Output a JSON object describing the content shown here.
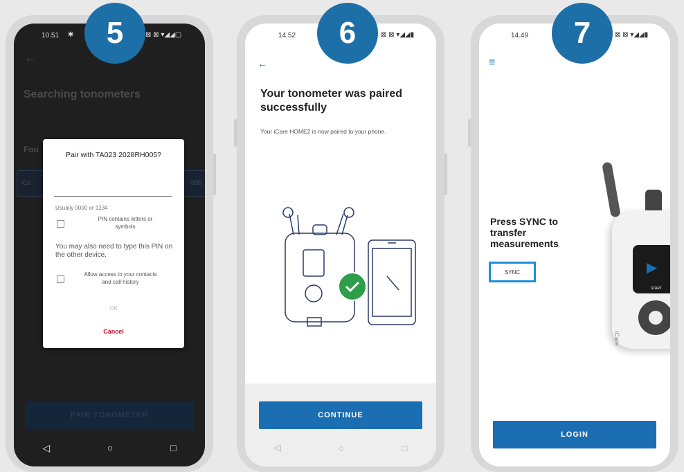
{
  "badges": [
    "5",
    "6",
    "7"
  ],
  "phone1": {
    "status_time": "10.51",
    "status_icons": "⊠ ⊠ ▾◢◢▢",
    "title": "Searching tonometers",
    "found_label": "Fou",
    "device_left": "iCa",
    "device_right": "005)",
    "bottom_button": "PAIR TONOMETER",
    "dialog": {
      "title": "Pair with TA023 2028RH005?",
      "hint": "Usually 0000 or 1234",
      "checkbox1": "PIN contains letters or symbols",
      "note": "You may also need to type this PIN on the other device.",
      "checkbox2": "Allow access to your contacts and call history",
      "ok": "OK",
      "cancel": "Cancel"
    }
  },
  "phone2": {
    "status_time": "14.52",
    "title": "Your tonometer was paired successfully",
    "subtitle": "Your iCare HOME2 is now paired to your phone.",
    "continue": "CONTINUE"
  },
  "phone3": {
    "status_time": "14.49",
    "headline": "Press SYNC to transfer measurements",
    "sync": "SYNC",
    "login": "LOGIN",
    "device_brand": "iCare",
    "device_start": "START"
  },
  "colors": {
    "badge": "#1d6fa8",
    "button": "#1b6eb1",
    "cancel": "#c8102e",
    "check": "#2e9e4a"
  }
}
